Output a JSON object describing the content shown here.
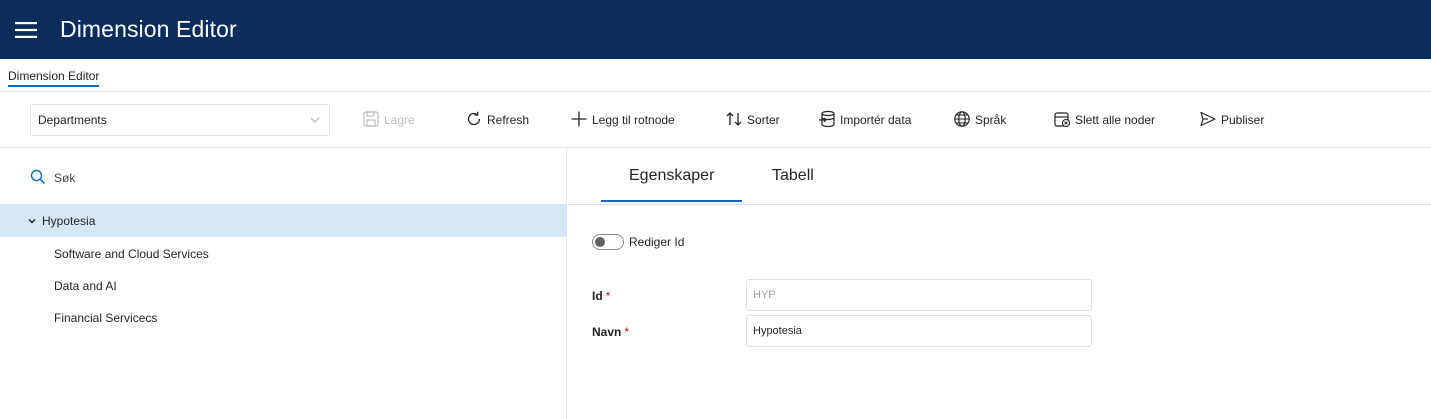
{
  "header": {
    "title": "Dimension Editor",
    "menu_icon": "hamburger-menu-icon"
  },
  "breadcrumb": {
    "label": "Dimension Editor"
  },
  "toolbar": {
    "dimension_select": {
      "value": "Departments"
    },
    "save_label": "Lagre",
    "refresh_label": "Refresh",
    "add_root_label": "Legg til rotnode",
    "sort_label": "Sorter",
    "import_label": "Importér data",
    "language_label": "Språk",
    "delete_all_label": "Slett alle noder",
    "publish_label": "Publiser"
  },
  "tree": {
    "search_placeholder": "Søk",
    "root": {
      "label": "Hypotesia",
      "expanded": true
    },
    "children": [
      "Software and Cloud Services",
      "Data and AI",
      "Financial Servicecs"
    ]
  },
  "details": {
    "tabs": [
      {
        "label": "Egenskaper",
        "active": true
      },
      {
        "label": "Tabell",
        "active": false
      }
    ],
    "toggle_label": "Rediger Id",
    "fields": [
      {
        "label": "Id",
        "required_mark": "*",
        "value": "HYP",
        "disabled": true
      },
      {
        "label": "Navn",
        "required_mark": "*",
        "value": "Hypotesia",
        "disabled": false
      }
    ]
  },
  "colors": {
    "header_bg": "#0b2d5c",
    "accent": "#0f6cbd",
    "selected_row": "#d6e6f5",
    "required": "#c50f1f"
  }
}
